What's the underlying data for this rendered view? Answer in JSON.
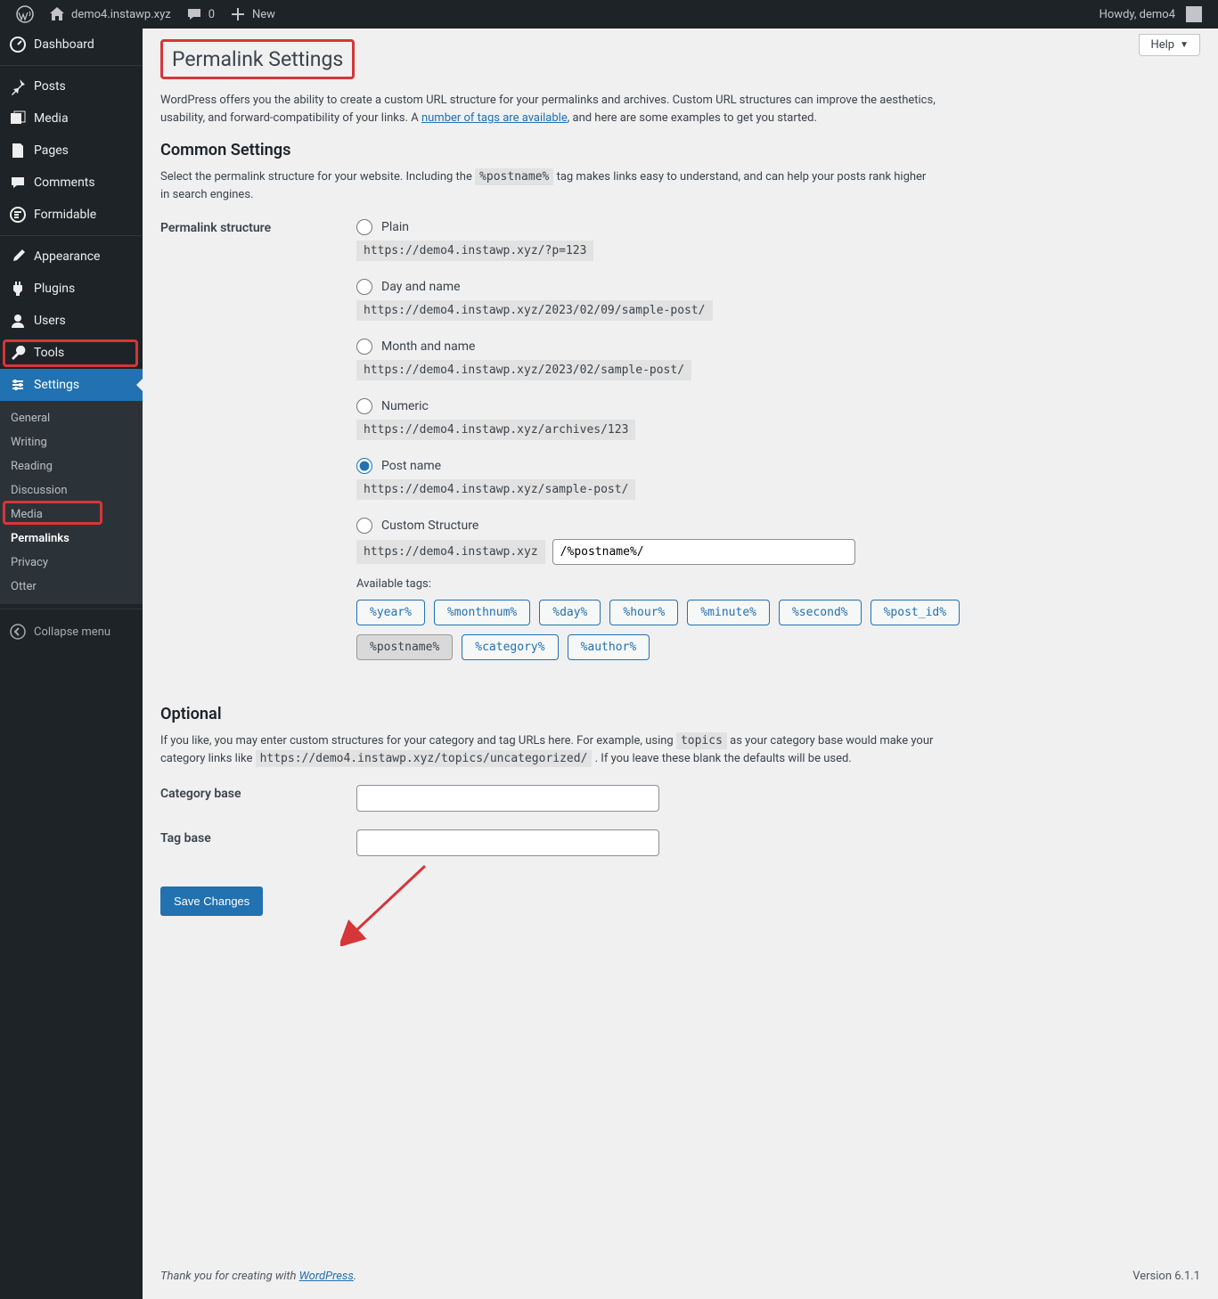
{
  "adminbar": {
    "site": "demo4.instawp.xyz",
    "comments": "0",
    "new": "New",
    "howdy": "Howdy, demo4"
  },
  "sidebar": {
    "dashboard": "Dashboard",
    "posts": "Posts",
    "media": "Media",
    "pages": "Pages",
    "comments": "Comments",
    "formidable": "Formidable",
    "appearance": "Appearance",
    "plugins": "Plugins",
    "users": "Users",
    "tools": "Tools",
    "settings": "Settings",
    "settings_sub": {
      "general": "General",
      "writing": "Writing",
      "reading": "Reading",
      "discussion": "Discussion",
      "media": "Media",
      "permalinks": "Permalinks",
      "privacy": "Privacy",
      "otter": "Otter"
    },
    "collapse": "Collapse menu"
  },
  "help": "Help",
  "page_title": "Permalink Settings",
  "intro_1": "WordPress offers you the ability to create a custom URL structure for your permalinks and archives. Custom URL structures can improve the aesthetics, usability, and forward-compatibility of your links. A ",
  "intro_link": "number of tags are available",
  "intro_2": ", and here are some examples to get you started.",
  "common_heading": "Common Settings",
  "common_desc_1": "Select the permalink structure for your website. Including the ",
  "common_code": "%postname%",
  "common_desc_2": " tag makes links easy to understand, and can help your posts rank higher in search engines.",
  "structure_label": "Permalink structure",
  "options": {
    "plain": {
      "label": "Plain",
      "example": "https://demo4.instawp.xyz/?p=123"
    },
    "dayname": {
      "label": "Day and name",
      "example": "https://demo4.instawp.xyz/2023/02/09/sample-post/"
    },
    "monthname": {
      "label": "Month and name",
      "example": "https://demo4.instawp.xyz/2023/02/sample-post/"
    },
    "numeric": {
      "label": "Numeric",
      "example": "https://demo4.instawp.xyz/archives/123"
    },
    "postname": {
      "label": "Post name",
      "example": "https://demo4.instawp.xyz/sample-post/"
    },
    "custom": {
      "label": "Custom Structure",
      "prefix": "https://demo4.instawp.xyz",
      "value": "/%postname%/"
    }
  },
  "available_tags_label": "Available tags:",
  "tags": [
    "%year%",
    "%monthnum%",
    "%day%",
    "%hour%",
    "%minute%",
    "%second%",
    "%post_id%",
    "%postname%",
    "%category%",
    "%author%"
  ],
  "optional_heading": "Optional",
  "optional_1": "If you like, you may enter custom structures for your category and tag URLs here. For example, using ",
  "optional_code1": "topics",
  "optional_2": " as your category base would make your category links like ",
  "optional_code2": "https://demo4.instawp.xyz/topics/uncategorized/",
  "optional_3": " . If you leave these blank the defaults will be used.",
  "category_base": "Category base",
  "tag_base": "Tag base",
  "save": "Save Changes",
  "footer_thank": "Thank you for creating with ",
  "footer_wp": "WordPress",
  "footer_dot": ".",
  "version": "Version 6.1.1"
}
